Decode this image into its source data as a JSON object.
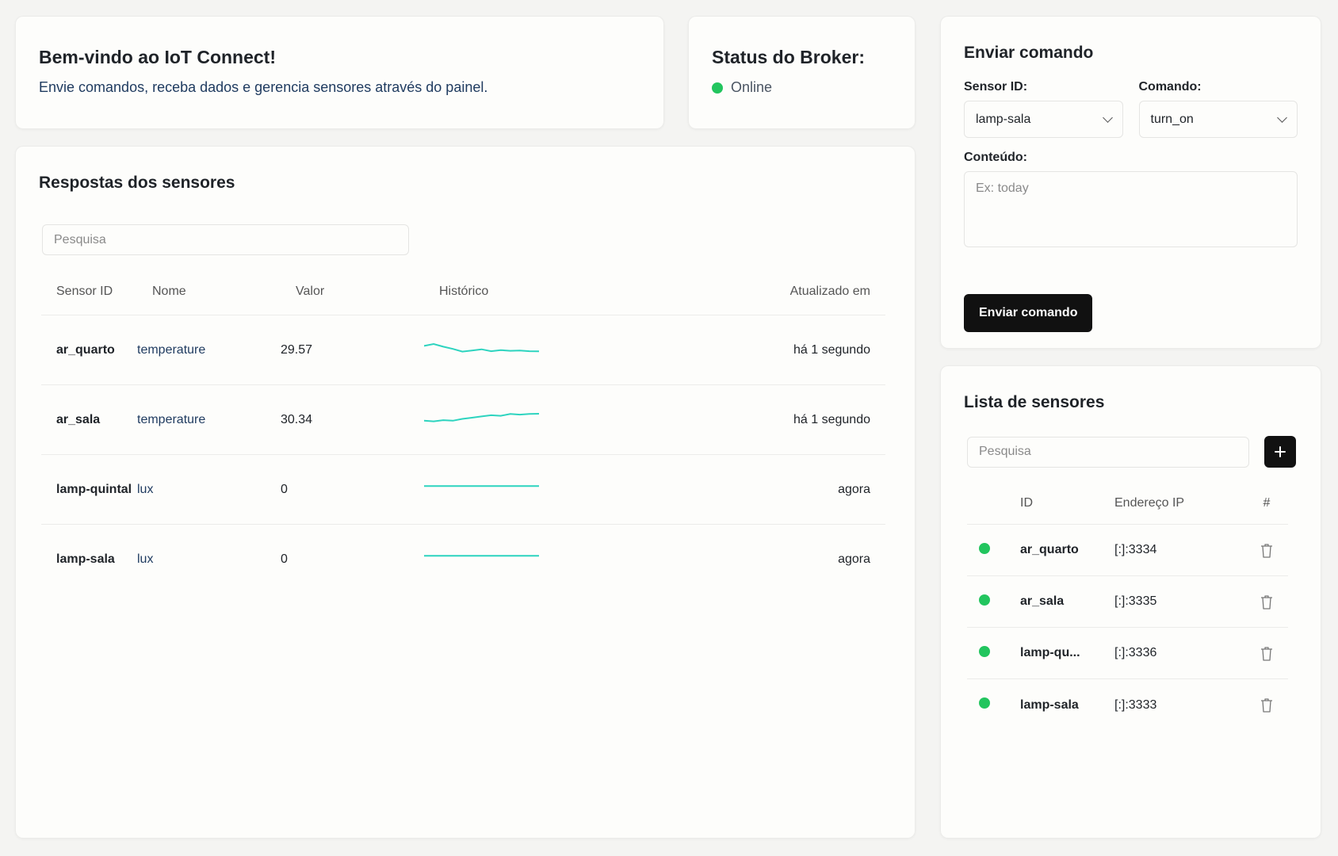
{
  "welcome": {
    "title": "Bem-vindo ao IoT Connect!",
    "subtitle": "Envie comandos, receba dados e gerencia sensores através do painel."
  },
  "broker": {
    "title": "Status do Broker:",
    "status": "Online",
    "status_color": "#22c55e"
  },
  "command": {
    "title": "Enviar comando",
    "sensor_label": "Sensor ID:",
    "sensor_value": "lamp-sala",
    "command_label": "Comando:",
    "command_value": "turn_on",
    "content_label": "Conteúdo:",
    "content_placeholder": "Ex: today",
    "submit_label": "Enviar comando"
  },
  "responses": {
    "title": "Respostas dos sensores",
    "search_placeholder": "Pesquisa",
    "columns": {
      "id": "Sensor ID",
      "name": "Nome",
      "value": "Valor",
      "history": "Histórico",
      "updated": "Atualizado em"
    },
    "rows": [
      {
        "id": "ar_quarto",
        "name": "temperature",
        "value": "29.57",
        "updated": "há 1 segundo",
        "history": [
          31,
          31.5,
          30.8,
          30.2,
          29.5,
          29.8,
          30.1,
          29.6,
          29.9,
          29.7,
          29.8,
          29.6,
          29.57
        ]
      },
      {
        "id": "ar_sala",
        "name": "temperature",
        "value": "30.34",
        "updated": "há 1 segundo",
        "history": [
          29.2,
          29.1,
          29.3,
          29.2,
          29.5,
          29.7,
          29.9,
          30.1,
          30.0,
          30.3,
          30.2,
          30.3,
          30.34
        ]
      },
      {
        "id": "lamp-quintal",
        "name": "lux",
        "value": "0",
        "updated": "agora",
        "history": [
          0,
          0,
          0,
          0,
          0,
          0,
          0,
          0,
          0,
          0,
          0,
          0,
          0
        ]
      },
      {
        "id": "lamp-sala",
        "name": "lux",
        "value": "0",
        "updated": "agora",
        "history": [
          0,
          0,
          0,
          0,
          0,
          0,
          0,
          0,
          0,
          0,
          0,
          0,
          0
        ]
      }
    ],
    "spark_color": "#2dd4bf"
  },
  "sensors": {
    "title": "Lista de sensores",
    "search_placeholder": "Pesquisa",
    "columns": {
      "id": "ID",
      "ip": "Endereço IP",
      "actions": "#"
    },
    "rows": [
      {
        "id": "ar_quarto",
        "ip": "[:]:3334"
      },
      {
        "id": "ar_sala",
        "ip": "[:]:3335"
      },
      {
        "id": "lamp-qu...",
        "ip": "[:]:3336"
      },
      {
        "id": "lamp-sala",
        "ip": "[:]:3333"
      }
    ]
  }
}
